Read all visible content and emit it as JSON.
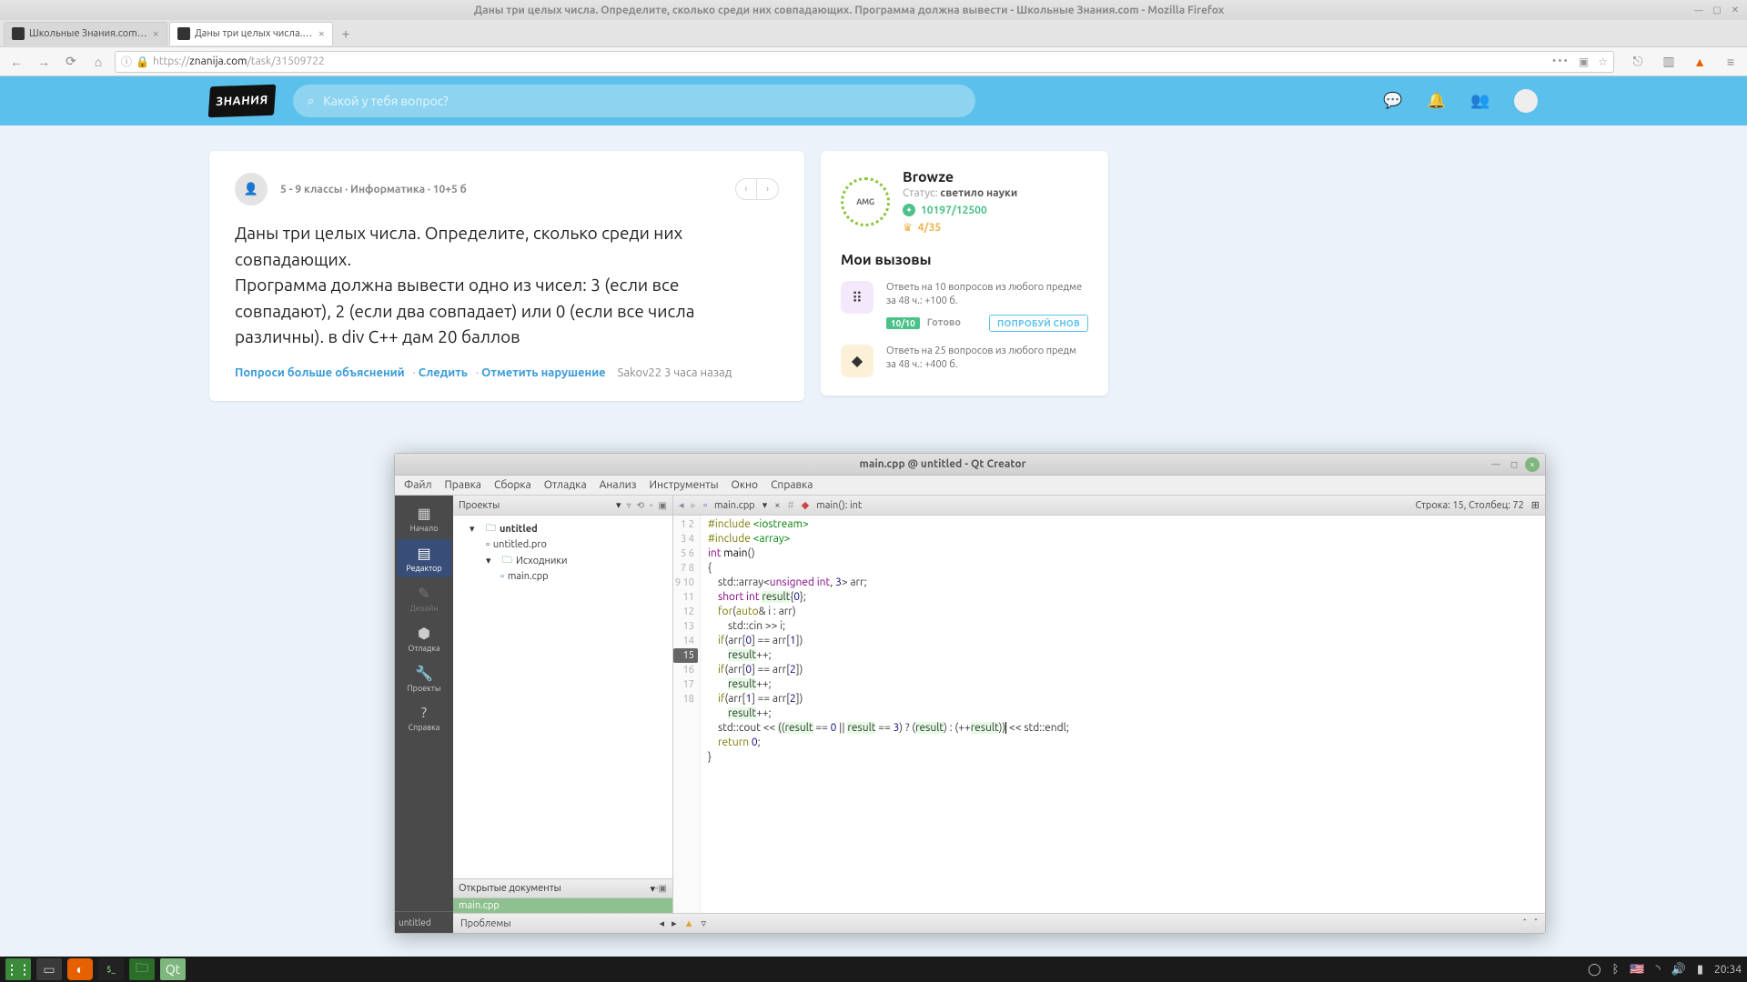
{
  "window": {
    "title": "Даны три целых числа. Определите, сколько среди них совпадающих. Программа должна вывести - Школьные Знания.com - Mozilla Firefox"
  },
  "tabs": [
    {
      "title": "Школьные Знания.com - Ре"
    },
    {
      "title": "Даны три целых числа. Оп"
    }
  ],
  "url": {
    "host": "znanija.com",
    "path": "/task/31509722",
    "prefix": "https://"
  },
  "brand": {
    "logo": "ЗНАНИЯ"
  },
  "search": {
    "placeholder": "Какой у тебя вопрос?"
  },
  "question": {
    "meta": "5 - 9 классы · Информатика · 10+5 б",
    "body": "Даны три целых числа. Определите, сколько среди них совпадающих.\nПрограмма должна вывести одно из чисел: 3 (если все совпадают), 2 (если два совпадает) или 0 (если все числа различны). в div C++ дам 20 баллов",
    "ask_more": "Попроси больше объяснений",
    "follow": "Следить",
    "report": "Отметить нарушение",
    "author": "Sakov22 3 часа назад"
  },
  "sidebar": {
    "user": {
      "name": "Browze",
      "badge": "AMG",
      "status_label": "Статус:",
      "status_value": "светило науки",
      "points": "10197/12500",
      "rank": "4/35"
    },
    "challenges_title": "Мои вызовы",
    "challenges": [
      {
        "text": "Ответь на 10 вопросов из любого предме за 48 ч.: +100 б.",
        "score": "10/10",
        "ready": "Готово",
        "btn": "ПОПРОБУЙ СНОВ"
      },
      {
        "text": "Ответь на 25 вопросов из любого предм за 48 ч.: +400 б."
      }
    ]
  },
  "qt": {
    "title": "main.cpp @ untitled - Qt Creator",
    "menu": [
      "Файл",
      "Правка",
      "Сборка",
      "Отладка",
      "Анализ",
      "Инструменты",
      "Окно",
      "Справка"
    ],
    "modes": [
      {
        "label": "Начало",
        "icon": "⠿"
      },
      {
        "label": "Редактор",
        "icon": "▤",
        "active": true
      },
      {
        "label": "Дизайн",
        "icon": "✎",
        "disabled": true
      },
      {
        "label": "Отладка",
        "icon": "⬢"
      },
      {
        "label": "Проекты",
        "icon": "🔧"
      },
      {
        "label": "Справка",
        "icon": "?"
      }
    ],
    "proj_header": "Проекты",
    "tree": {
      "project": "untitled",
      "pro": "untitled.pro",
      "sources": "Исходники",
      "main": "main.cpp"
    },
    "open_docs_label": "Открытые документы",
    "open_doc": "main.cpp",
    "bottom_proj": "untitled",
    "editor": {
      "file": "main.cpp",
      "symbol": "main(): int",
      "position": "Строка: 15, Столбец: 72"
    },
    "code_lines": 17,
    "problems_label": "Проблемы"
  },
  "taskbar": {
    "time": "20:34"
  }
}
